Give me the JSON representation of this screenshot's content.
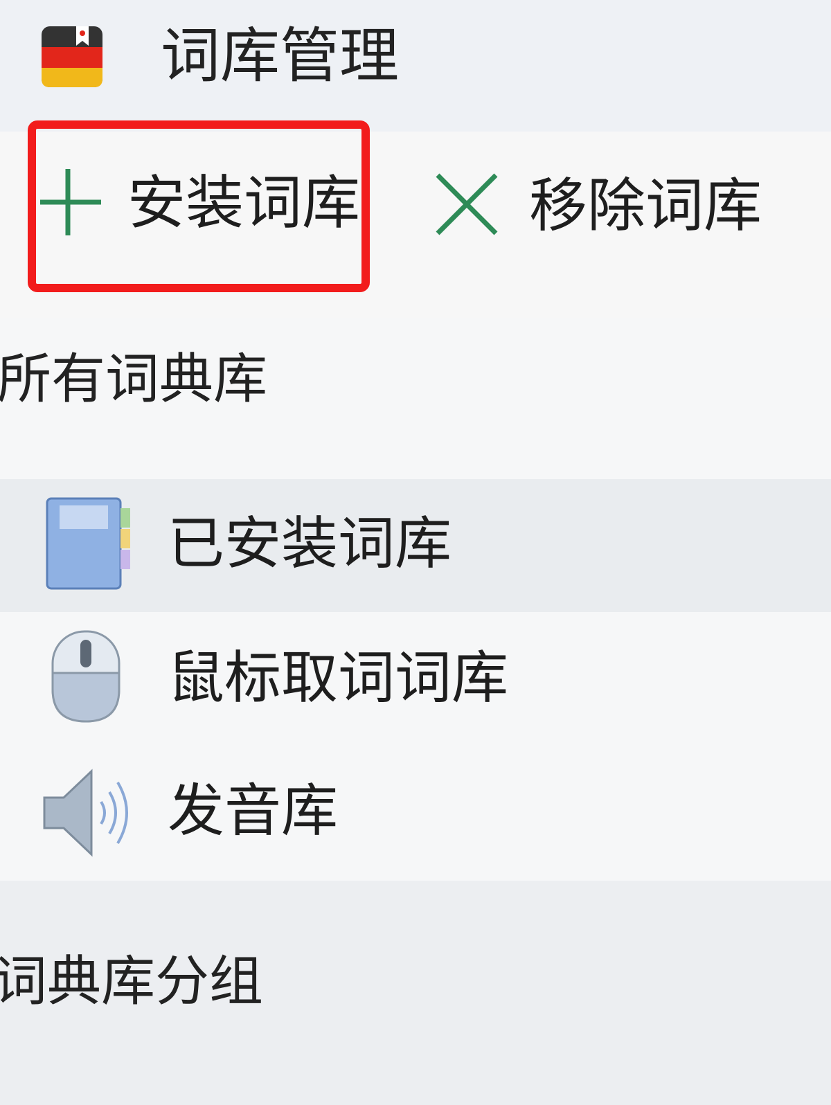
{
  "window": {
    "title": "词库管理",
    "icon": "german-flag-book-icon"
  },
  "toolbar": {
    "install_label": "安装词库",
    "remove_label": "移除词库",
    "install_icon": "plus-icon",
    "remove_icon": "x-icon",
    "accent_color": "#2e8b57",
    "highlight_color": "#f21c1c"
  },
  "sections": {
    "all_heading": "所有词典库",
    "group_heading": "词典库分组"
  },
  "nav": {
    "items": [
      {
        "label": "已安装词库",
        "icon": "notebook-icon",
        "selected": true
      },
      {
        "label": "鼠标取词词库",
        "icon": "mouse-icon",
        "selected": false
      },
      {
        "label": "发音库",
        "icon": "speaker-icon",
        "selected": false
      }
    ]
  }
}
